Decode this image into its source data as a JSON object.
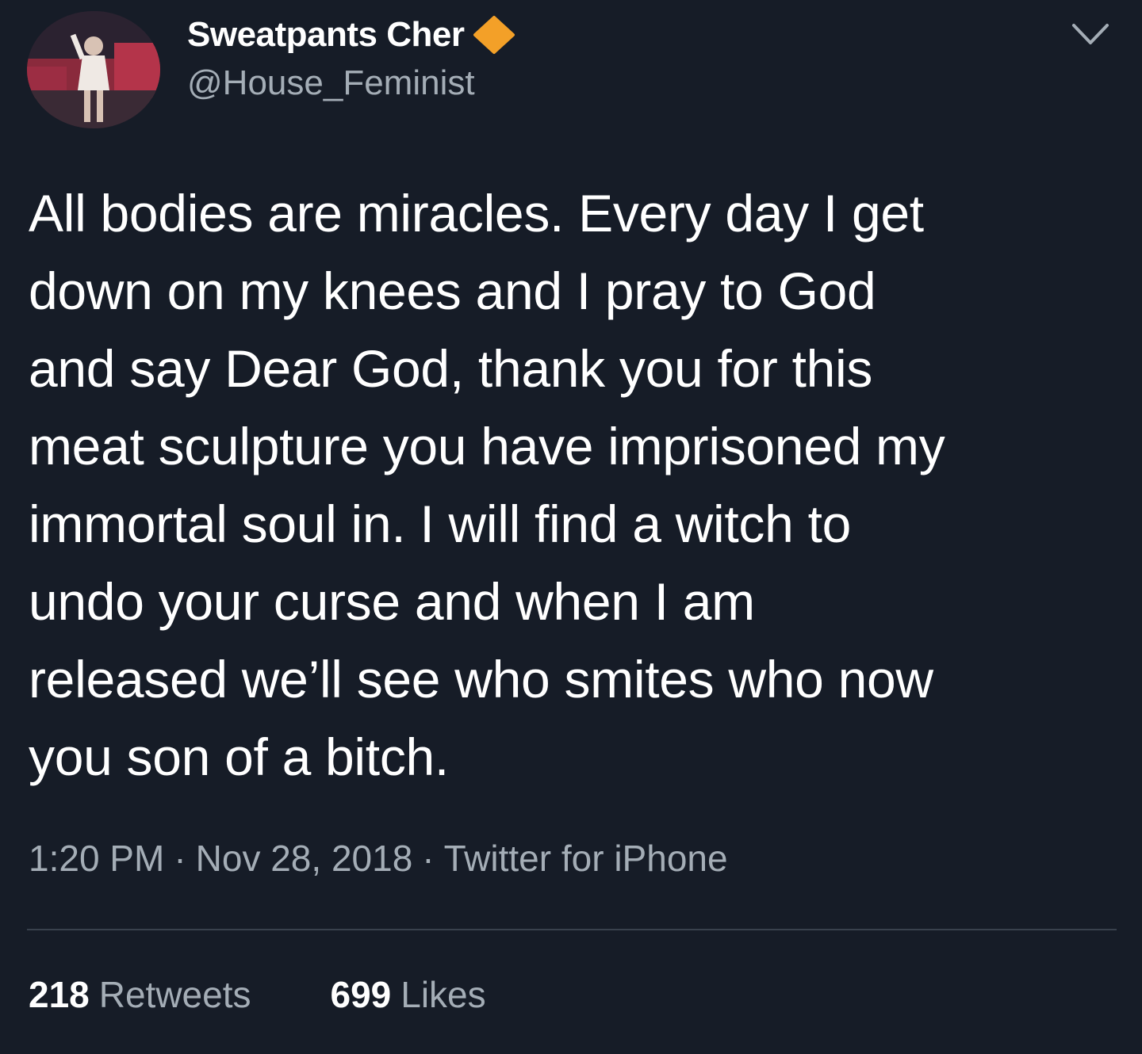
{
  "author": {
    "display_name": "Sweatpants Cher",
    "handle": "@House_Feminist",
    "avatar_icon": "profile-photo",
    "badge_icon": "orange-diamond-icon",
    "badge_color": "#f3a028"
  },
  "menu": {
    "icon": "chevron-down-icon"
  },
  "tweet": {
    "lines": [
      "All bodies are miracles. Every day I get",
      "down on my knees and I pray to God",
      "and say Dear God, thank you for this",
      "meat sculpture you have imprisoned my",
      "immortal soul in. I will find a witch to",
      "undo your curse and when I am",
      "released we’ll see who smites who now",
      "you son of a bitch."
    ]
  },
  "meta": {
    "time": "1:20 PM",
    "separator": "·",
    "date": "Nov 28, 2018",
    "source": "Twitter for iPhone"
  },
  "stats": {
    "retweets_count": "218",
    "retweets_label": "Retweets",
    "likes_count": "699",
    "likes_label": "Likes"
  },
  "colors": {
    "background": "#161c27",
    "text_primary": "#ffffff",
    "text_secondary": "#a4adb6",
    "divider": "#39414d"
  }
}
